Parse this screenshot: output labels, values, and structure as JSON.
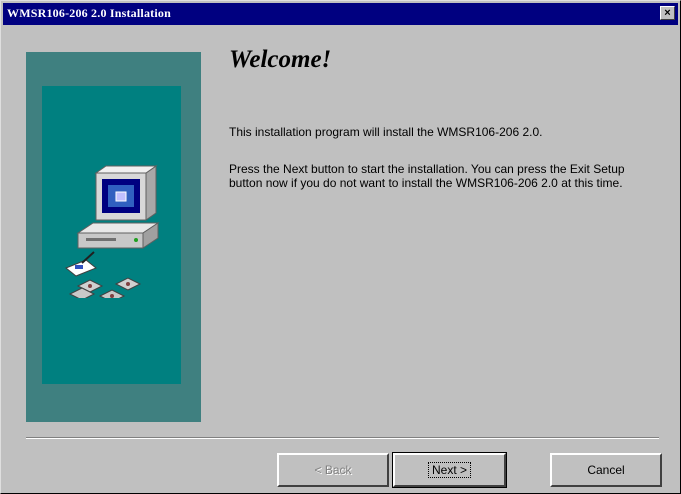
{
  "window": {
    "title": "WMSR106-206 2.0 Installation",
    "close_label": "×"
  },
  "heading": "Welcome!",
  "body": {
    "paragraph1": "This installation program will install the WMSR106-206 2.0.",
    "paragraph2": "Press the Next button to start the installation. You can press the Exit Setup button now if you do not want to install the WMSR106-206 2.0 at this time."
  },
  "buttons": {
    "back": "< Back",
    "next": "Next >",
    "cancel": "Cancel"
  },
  "colors": {
    "titlebar": "#000080",
    "panel_outer": "#3f8080",
    "panel_inner": "#008080",
    "face": "#c0c0c0"
  }
}
